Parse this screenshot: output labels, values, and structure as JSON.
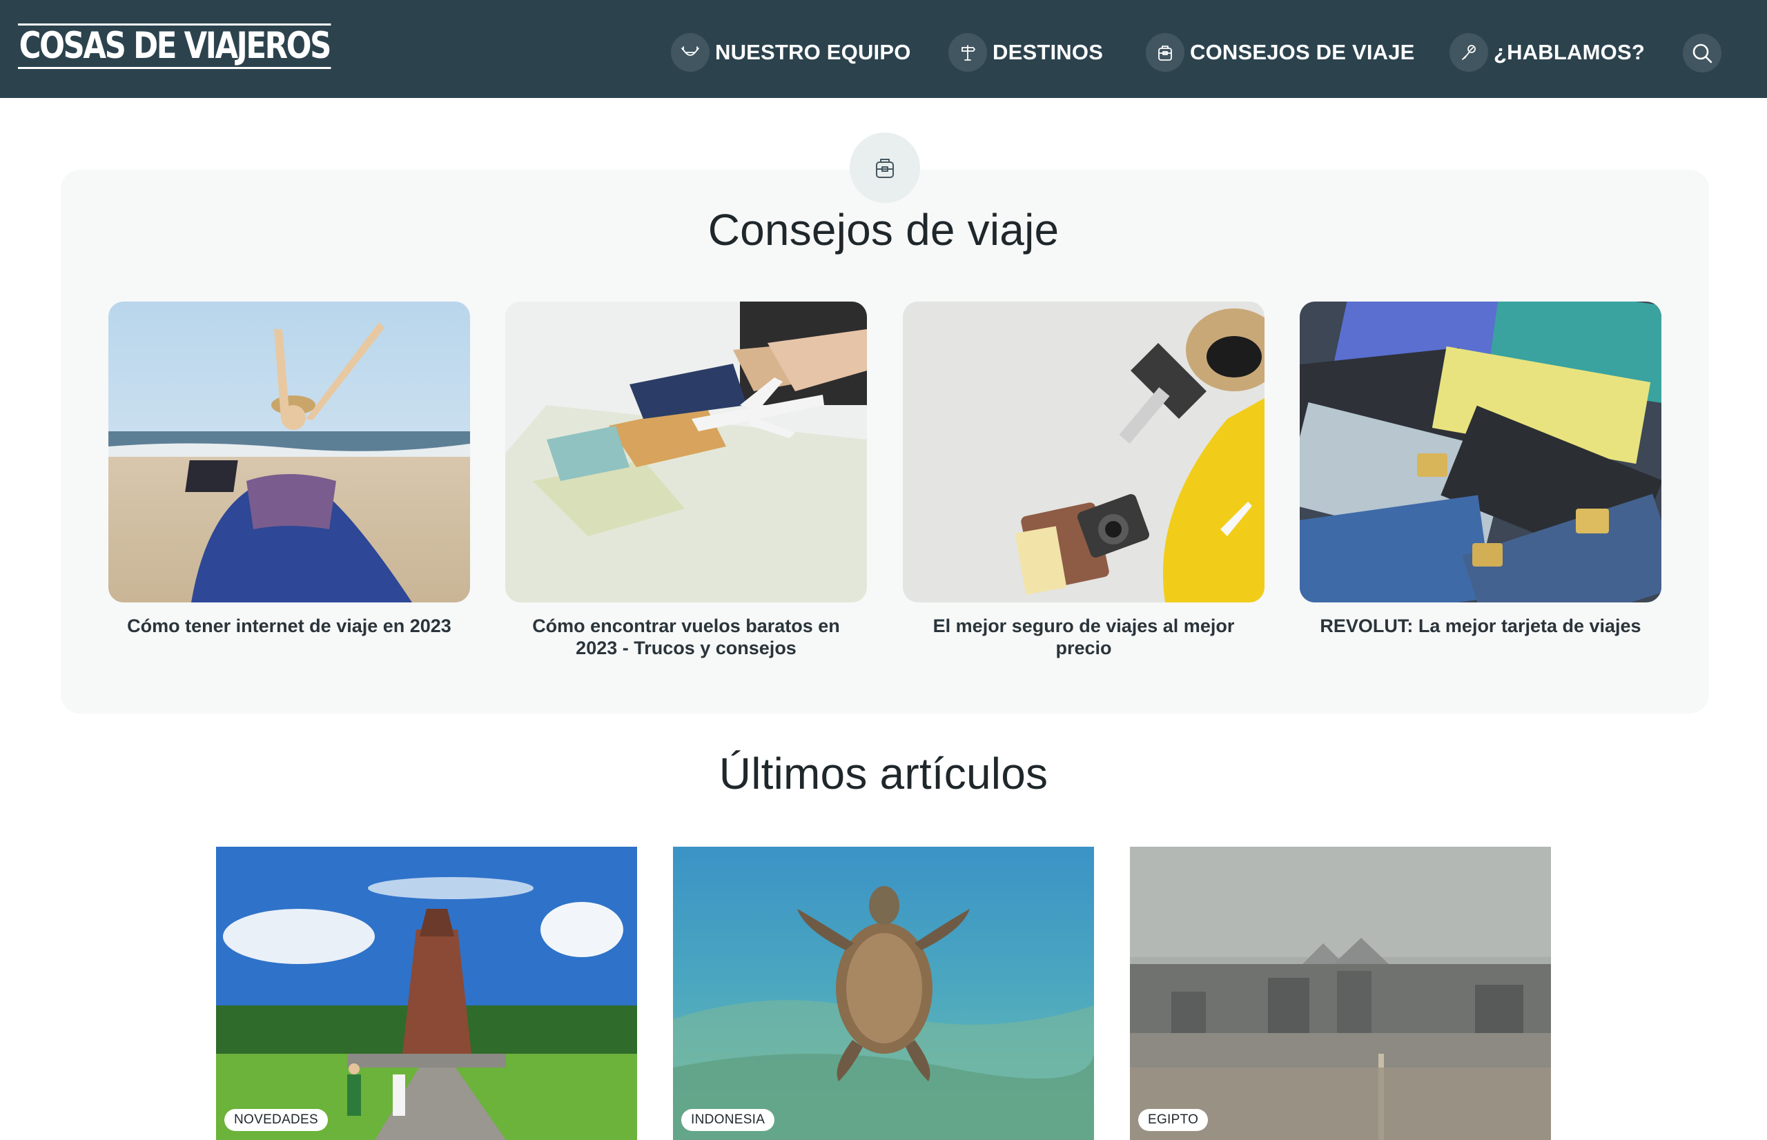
{
  "header": {
    "logo": "COSAS DE VIAJEROS",
    "nav": [
      {
        "label": "NUESTRO EQUIPO",
        "icon": "hammock-icon"
      },
      {
        "label": "DESTINOS",
        "icon": "signpost-icon"
      },
      {
        "label": "CONSEJOS DE VIAJE",
        "icon": "backpack-icon"
      },
      {
        "label": "¿HABLAMOS?",
        "icon": "chat-icon"
      }
    ],
    "search_icon": "search-icon"
  },
  "tips": {
    "badge_icon": "backpack-icon",
    "title": "Consejos de viaje",
    "cards": [
      {
        "caption": "Cómo tener internet de viaje en 2023",
        "image": "beach-laptop"
      },
      {
        "caption": "Cómo encontrar vuelos baratos en 2023 - Trucos y consejos",
        "image": "map-airplane"
      },
      {
        "caption": "El mejor seguro de viajes al mejor precio",
        "image": "suitcase-camera"
      },
      {
        "caption": "REVOLUT: La mejor tarjeta de viajes",
        "image": "credit-cards"
      }
    ]
  },
  "latest": {
    "title": "Últimos artículos",
    "articles": [
      {
        "tag": "NOVEDADES",
        "image": "bali-temple"
      },
      {
        "tag": "INDONESIA",
        "image": "sea-turtle"
      },
      {
        "tag": "EGIPTO",
        "image": "cairo-pyramids"
      }
    ]
  },
  "colors": {
    "header_bg": "#2c434e",
    "panel_bg": "#f7f8f8",
    "text": "#1f272b"
  }
}
